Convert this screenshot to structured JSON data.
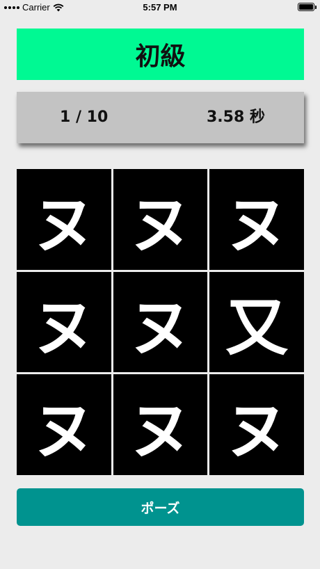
{
  "status_bar": {
    "carrier": "Carrier",
    "time": "5:57 PM",
    "battery_level": 1.0
  },
  "level": {
    "title": "初級",
    "color": "#00f993"
  },
  "score": {
    "progress": "1 / 10",
    "time_value": "3.58",
    "time_unit": "秒"
  },
  "grid": {
    "cells": [
      "ヌ",
      "ヌ",
      "ヌ",
      "ヌ",
      "ヌ",
      "又",
      "ヌ",
      "ヌ",
      "ヌ"
    ]
  },
  "controls": {
    "pause_label": "ポーズ",
    "pause_color": "#00938f"
  }
}
